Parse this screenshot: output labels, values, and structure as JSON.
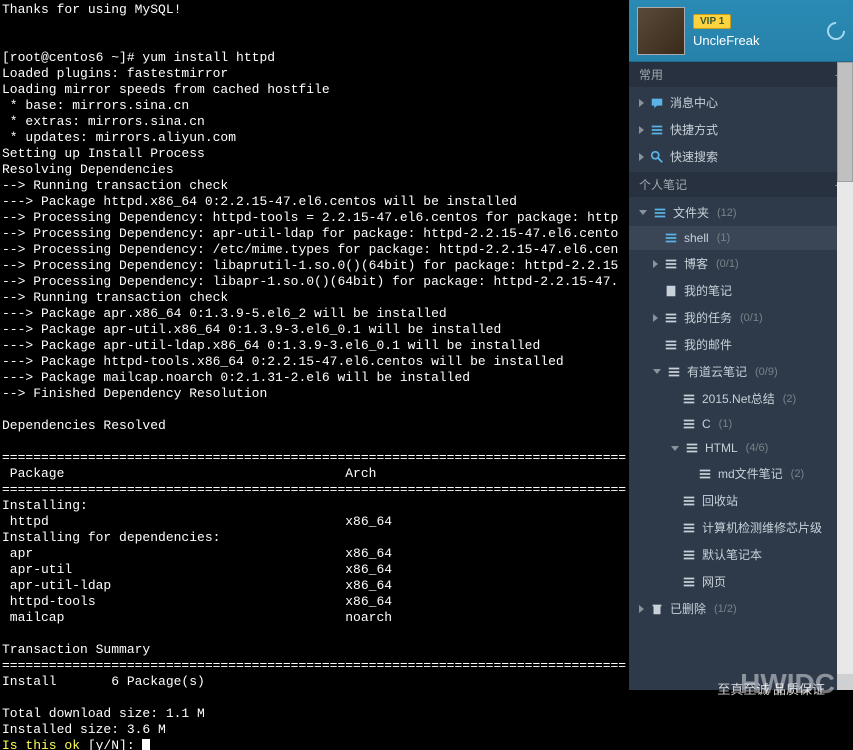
{
  "terminal": {
    "lines": "Thanks for using MySQL!\n\n\n[root@centos6 ~]# yum install httpd\nLoaded plugins: fastestmirror\nLoading mirror speeds from cached hostfile\n * base: mirrors.sina.cn\n * extras: mirrors.sina.cn\n * updates: mirrors.aliyun.com\nSetting up Install Process\nResolving Dependencies\n--> Running transaction check\n---> Package httpd.x86_64 0:2.2.15-47.el6.centos will be installed\n--> Processing Dependency: httpd-tools = 2.2.15-47.el6.centos for package: http\n--> Processing Dependency: apr-util-ldap for package: httpd-2.2.15-47.el6.cento\n--> Processing Dependency: /etc/mime.types for package: httpd-2.2.15-47.el6.cen\n--> Processing Dependency: libaprutil-1.so.0()(64bit) for package: httpd-2.2.15\n--> Processing Dependency: libapr-1.so.0()(64bit) for package: httpd-2.2.15-47.\n--> Running transaction check\n---> Package apr.x86_64 0:1.3.9-5.el6_2 will be installed\n---> Package apr-util.x86_64 0:1.3.9-3.el6_0.1 will be installed\n---> Package apr-util-ldap.x86_64 0:1.3.9-3.el6_0.1 will be installed\n---> Package httpd-tools.x86_64 0:2.2.15-47.el6.centos will be installed\n---> Package mailcap.noarch 0:2.1.31-2.el6 will be installed\n--> Finished Dependency Resolution\n\nDependencies Resolved\n\n================================================================================\n Package                                    Arch\n================================================================================\nInstalling:\n httpd                                      x86_64\nInstalling for dependencies:\n apr                                        x86_64\n apr-util                                   x86_64\n apr-util-ldap                              x86_64\n httpd-tools                                x86_64\n mailcap                                    noarch\n\nTransaction Summary\n================================================================================\nInstall       6 Package(s)\n\nTotal download size: 1.1 M\nInstalled size: 3.6 M",
    "prompt_question": "Is this ok [y/N]: ",
    "prompt_yellow": "Is this ok"
  },
  "user": {
    "vip": "VIP 1",
    "name": "UncleFreak"
  },
  "sections": {
    "common": "常用",
    "personal": "个人笔记"
  },
  "common_items": {
    "msg": "消息中心",
    "shortcut": "快捷方式",
    "qsearch": "快速搜索"
  },
  "tree": {
    "folders": {
      "label": "文件夹",
      "count": "(12)"
    },
    "shell": {
      "label": "shell",
      "count": "(1)"
    },
    "blog": {
      "label": "博客",
      "count": "(0/1)"
    },
    "mynotes": {
      "label": "我的笔记"
    },
    "mytasks": {
      "label": "我的任务",
      "count": "(0/1)"
    },
    "mymail": {
      "label": "我的邮件"
    },
    "youdao": {
      "label": "有道云笔记",
      "count": "(0/9)"
    },
    "net2015": {
      "label": "2015.Net总结",
      "count": "(2)"
    },
    "c": {
      "label": "C",
      "count": "(1)"
    },
    "html": {
      "label": "HTML",
      "count": "(4/6)"
    },
    "mdnote": {
      "label": "md文件笔记",
      "count": "(2)"
    },
    "recycle": {
      "label": "回收站"
    },
    "computer": {
      "label": "计算机检测维修芯片级"
    },
    "default": {
      "label": "默认笔记本"
    },
    "web": {
      "label": "网页"
    },
    "deleted": {
      "label": "已删除",
      "count": "(1/2)"
    }
  },
  "watermark": "HWIDC",
  "footer": "至真至诚 品质保证"
}
